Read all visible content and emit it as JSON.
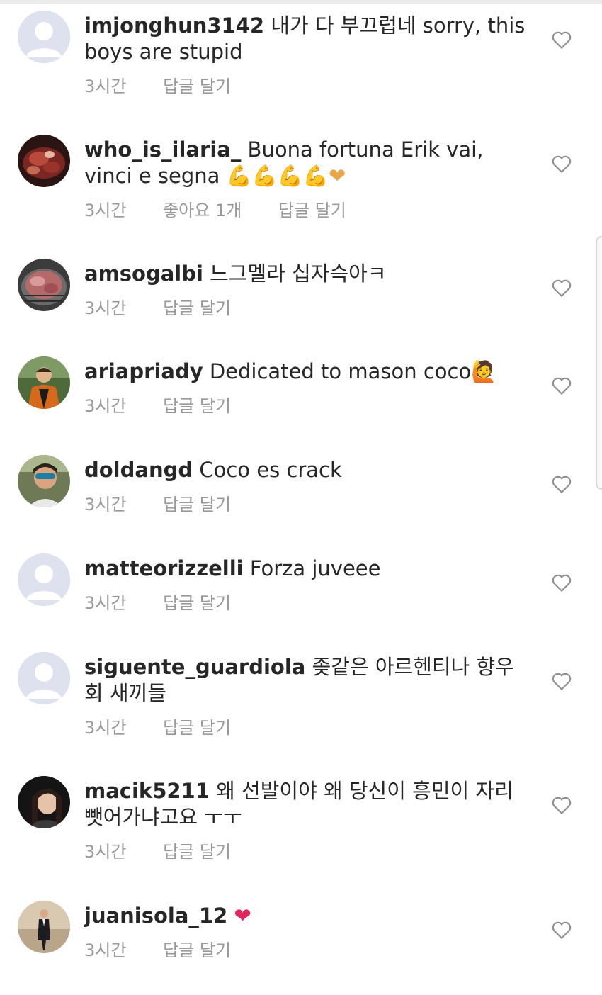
{
  "comments": [
    {
      "username": "imjonghun3142",
      "text": "내가 다 부끄럽네 sorry, this boys are stupid",
      "emoji": "",
      "time": "3시간",
      "likes": "",
      "reply": "답글 달기",
      "avatar": "default-avatar-icon"
    },
    {
      "username": "who_is_ilaria_",
      "text": "Buona fortuna Erik vai, vinci e segna",
      "emoji": "💪💪💪💪❤",
      "time": "3시간",
      "likes": "좋아요 1개",
      "reply": "답글 달기",
      "avatar": "profile-photo"
    },
    {
      "username": "amsogalbi",
      "text": "느그멜라 십자슥아ㅋ",
      "emoji": "",
      "time": "3시간",
      "likes": "",
      "reply": "답글 달기",
      "avatar": "profile-photo"
    },
    {
      "username": "ariapriady",
      "text": "Dedicated to mason coco",
      "emoji": "🙋",
      "time": "3시간",
      "likes": "",
      "reply": "답글 달기",
      "avatar": "profile-photo"
    },
    {
      "username": "doldangd",
      "text": "Coco es crack",
      "emoji": "",
      "time": "3시간",
      "likes": "",
      "reply": "답글 달기",
      "avatar": "profile-photo"
    },
    {
      "username": "matteorizzelli",
      "text": "Forza juveee",
      "emoji": "",
      "time": "3시간",
      "likes": "",
      "reply": "답글 달기",
      "avatar": "default-avatar-icon"
    },
    {
      "username": "siguente_guardiola",
      "text": "좆같은 아르헨티나 향우회 새끼들",
      "emoji": "",
      "time": "3시간",
      "likes": "",
      "reply": "답글 달기",
      "avatar": "default-avatar-icon"
    },
    {
      "username": "macik5211",
      "text": "왜 선발이야 왜 당신이 흥민이 자리 뺏어가냐고요 ㅜㅜ",
      "emoji": "",
      "time": "3시간",
      "likes": "",
      "reply": "답글 달기",
      "avatar": "profile-photo"
    },
    {
      "username": "juanisola_12",
      "text": "",
      "emoji": "❤",
      "time": "3시간",
      "likes": "",
      "reply": "답글 달기",
      "avatar": "profile-photo"
    }
  ],
  "icons": {
    "like": "heart-outline-icon",
    "default_avatar": "default-avatar-icon"
  },
  "colors": {
    "text": "#262626",
    "meta": "#999999",
    "heart": "#e0245e",
    "divider": "#ececec"
  }
}
